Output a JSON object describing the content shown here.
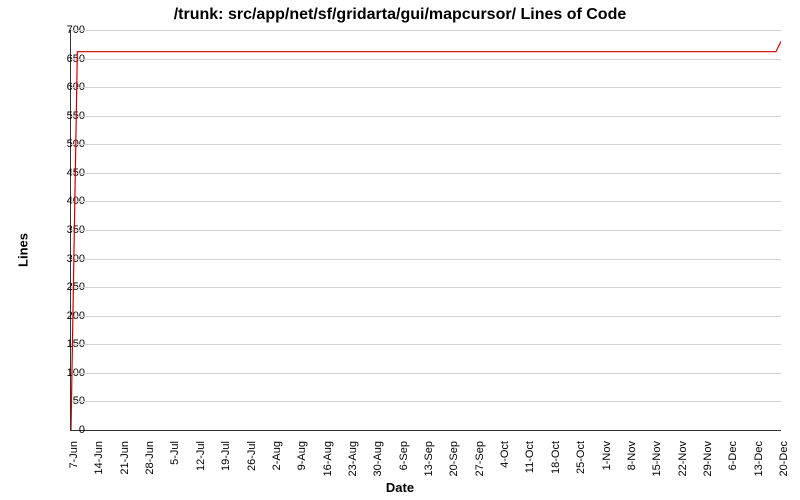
{
  "chart_data": {
    "type": "line",
    "title": "/trunk: src/app/net/sf/gridarta/gui/mapcursor/ Lines of Code",
    "xlabel": "Date",
    "ylabel": "Lines",
    "ylim": [
      0,
      700
    ],
    "y_ticks": [
      0,
      50,
      100,
      150,
      200,
      250,
      300,
      350,
      400,
      450,
      500,
      550,
      600,
      650,
      700
    ],
    "x_ticks": [
      "7-Jun",
      "14-Jun",
      "21-Jun",
      "28-Jun",
      "5-Jul",
      "12-Jul",
      "19-Jul",
      "26-Jul",
      "2-Aug",
      "9-Aug",
      "16-Aug",
      "23-Aug",
      "30-Aug",
      "6-Sep",
      "13-Sep",
      "20-Sep",
      "27-Sep",
      "4-Oct",
      "11-Oct",
      "18-Oct",
      "25-Oct",
      "1-Nov",
      "8-Nov",
      "15-Nov",
      "22-Nov",
      "29-Nov",
      "6-Dec",
      "13-Dec",
      "20-Dec"
    ],
    "series": [
      {
        "name": "Lines of Code",
        "color": "#d00000",
        "points": [
          {
            "x_index": 0,
            "y": 0
          },
          {
            "x_index": 0.25,
            "y": 662
          },
          {
            "x_index": 27.8,
            "y": 662
          },
          {
            "x_index": 28.0,
            "y": 680
          }
        ]
      }
    ]
  }
}
